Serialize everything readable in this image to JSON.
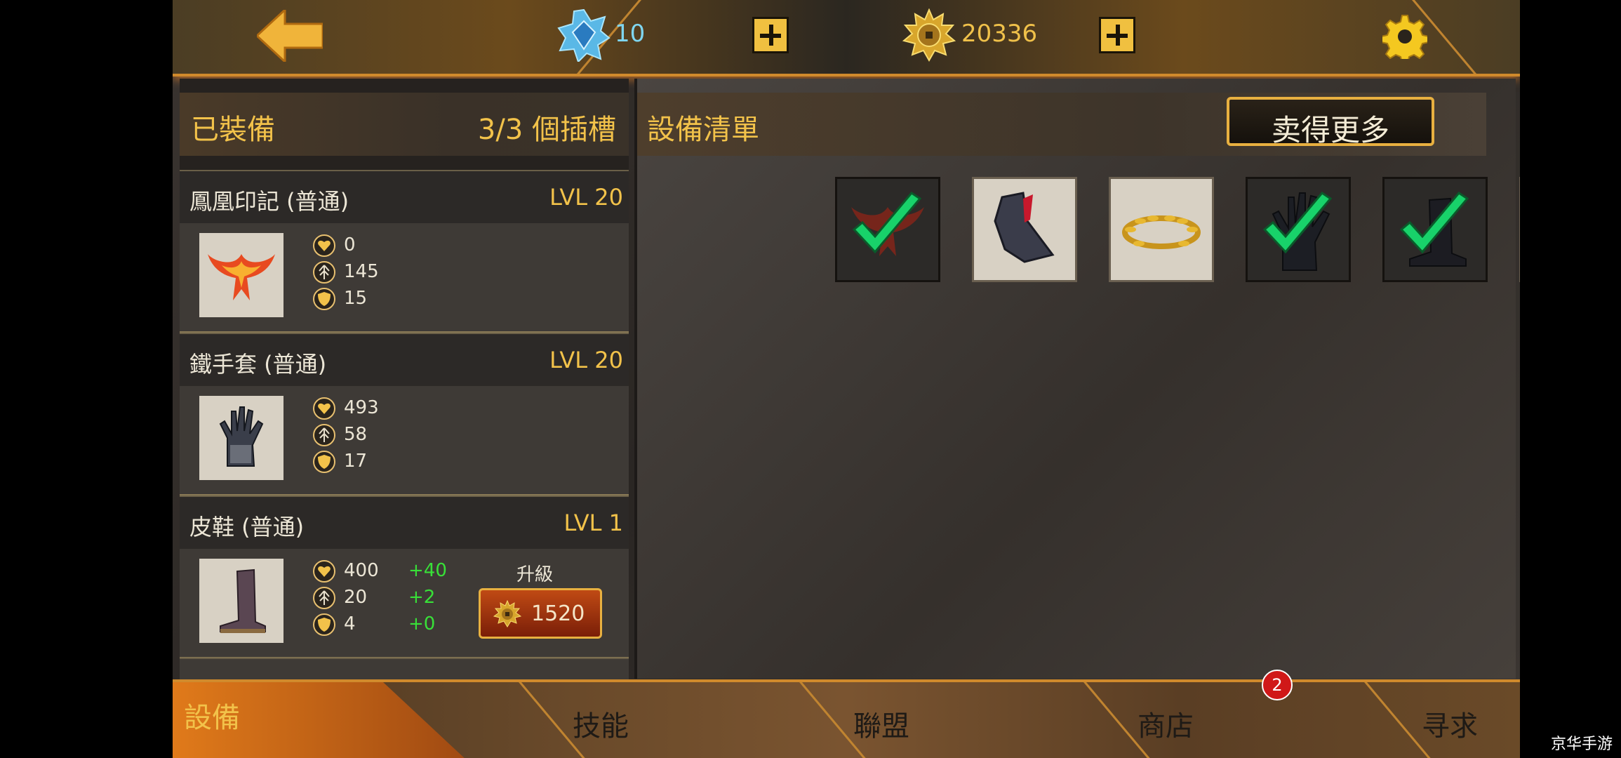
{
  "topbar": {
    "gems": "10",
    "coins": "20336",
    "icons": {
      "back": "back-arrow-icon",
      "gem": "gem-icon",
      "coin": "coin-icon",
      "settings": "gear-icon"
    }
  },
  "equipped": {
    "title": "已裝備",
    "slots": "3/3 個插槽",
    "items": [
      {
        "name": "鳳凰印記 (普通)",
        "level": "LVL 20",
        "stats": [
          "0",
          "145",
          "15"
        ]
      },
      {
        "name": "鐵手套 (普通)",
        "level": "LVL 20",
        "stats": [
          "493",
          "58",
          "17"
        ]
      },
      {
        "name": "皮鞋 (普通)",
        "level": "LVL 1",
        "stats": [
          "400",
          "20",
          "4"
        ],
        "bonus": [
          "+40",
          "+2",
          "+0"
        ],
        "upgrade_label": "升級",
        "upgrade_cost": "1520"
      }
    ]
  },
  "inventory": {
    "title": "設備清單",
    "sell_more": "卖得更多"
  },
  "nav": {
    "tabs": [
      "設備",
      "技能",
      "聯盟",
      "商店",
      "寻求"
    ],
    "quest_badge": "2"
  },
  "watermark": "京华手游",
  "colors": {
    "accent_gold": "#f2c24a",
    "bonus_green": "#38e038",
    "check_green": "#18d26a"
  }
}
